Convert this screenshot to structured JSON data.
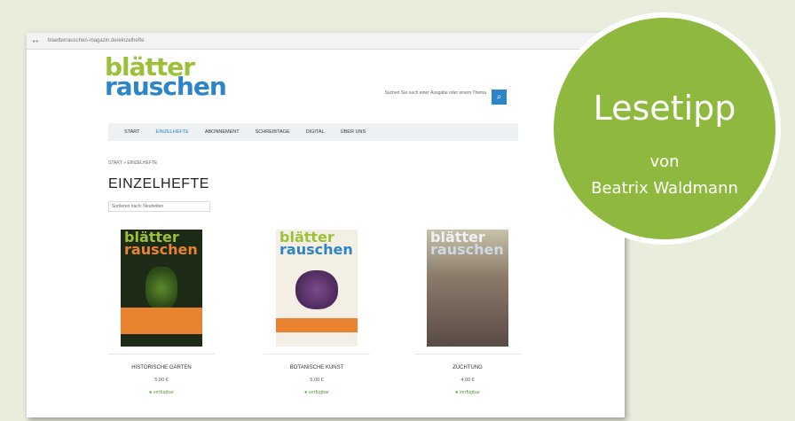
{
  "browser": {
    "url": "blaetterrauschen-magazin.de/einzelhefte"
  },
  "site": {
    "logo_line1": "blätter",
    "logo_line2": "rauschen",
    "search_hint": "Suchen Sie nach einer Ausgabe oder einem Thema",
    "search_icon": "search-icon"
  },
  "nav": {
    "items": [
      "Start",
      "Einzelhefte",
      "Abonnement",
      "Schreibtage",
      "Digital",
      "Über uns"
    ]
  },
  "breadcrumb": "Start » Einzelhefte",
  "page_title": "EINZELHEFTE",
  "sort_label": "Sortieren nach: Neuheiten",
  "products": [
    {
      "title": "Historische Gärten",
      "price": "5,00 €",
      "availability": "● verfügbar"
    },
    {
      "title": "Botanische Kunst",
      "price": "5,00 €",
      "availability": "● verfügbar"
    },
    {
      "title": "Züchtung",
      "price": "4,00 €",
      "availability": "● verfügbar"
    }
  ],
  "badge": {
    "headline": "Lesetipp",
    "von": "von",
    "author": "Beatrix Waldmann",
    "color": "#8fb93e"
  }
}
